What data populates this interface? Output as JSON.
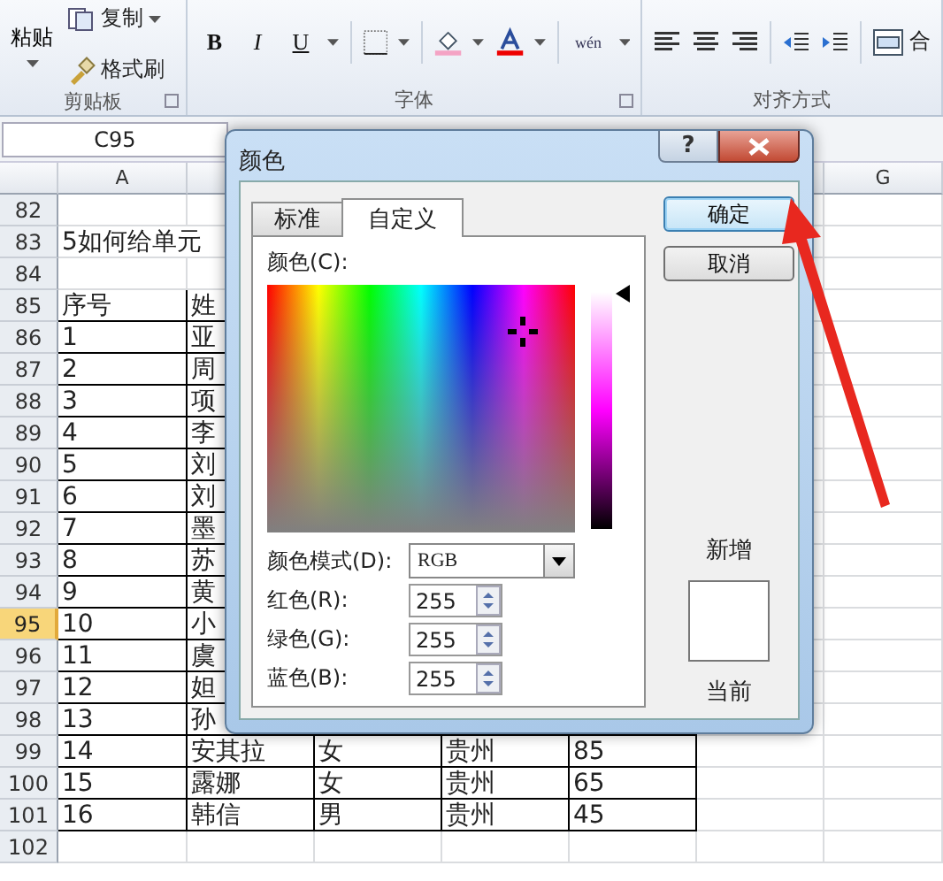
{
  "ribbon": {
    "groups": [
      {
        "kind": "clipboard",
        "label": "剪贴板",
        "paste": "粘贴",
        "copy": "复制",
        "format_painter": "格式刷"
      },
      {
        "kind": "font",
        "label": "字体",
        "bold": "B",
        "italic": "I",
        "underline": "U",
        "phonetic": "wén"
      },
      {
        "kind": "alignment",
        "label": "对齐方式",
        "merge": "合"
      }
    ]
  },
  "name_box": "C95",
  "sheet": {
    "column_headers": [
      "A",
      "G"
    ],
    "rows": [
      {
        "header": "82",
        "selected": false,
        "bordered": false,
        "cells": []
      },
      {
        "header": "83",
        "selected": false,
        "bordered": false,
        "cells": [
          "5如何给单元"
        ]
      },
      {
        "header": "84",
        "selected": false,
        "bordered": false,
        "cells": []
      },
      {
        "header": "85",
        "selected": false,
        "bordered": true,
        "cells": [
          "序号",
          "姓"
        ]
      },
      {
        "header": "86",
        "selected": false,
        "bordered": true,
        "cells": [
          "1",
          "亚"
        ]
      },
      {
        "header": "87",
        "selected": false,
        "bordered": true,
        "cells": [
          "2",
          "周"
        ]
      },
      {
        "header": "88",
        "selected": false,
        "bordered": true,
        "cells": [
          "3",
          "项"
        ]
      },
      {
        "header": "89",
        "selected": false,
        "bordered": true,
        "cells": [
          "4",
          "李"
        ]
      },
      {
        "header": "90",
        "selected": false,
        "bordered": true,
        "cells": [
          "5",
          "刘"
        ]
      },
      {
        "header": "91",
        "selected": false,
        "bordered": true,
        "cells": [
          "6",
          "刘"
        ]
      },
      {
        "header": "92",
        "selected": false,
        "bordered": true,
        "cells": [
          "7",
          "墨"
        ]
      },
      {
        "header": "93",
        "selected": false,
        "bordered": true,
        "cells": [
          "8",
          "苏"
        ]
      },
      {
        "header": "94",
        "selected": false,
        "bordered": true,
        "cells": [
          "9",
          "黄"
        ]
      },
      {
        "header": "95",
        "selected": true,
        "bordered": true,
        "cells": [
          "10",
          "小"
        ]
      },
      {
        "header": "96",
        "selected": false,
        "bordered": true,
        "cells": [
          "11",
          "虞"
        ]
      },
      {
        "header": "97",
        "selected": false,
        "bordered": true,
        "cells": [
          "12",
          "妲"
        ]
      },
      {
        "header": "98",
        "selected": false,
        "bordered": true,
        "cells": [
          "13",
          "孙"
        ]
      },
      {
        "header": "99",
        "selected": false,
        "bordered": true,
        "cells": [
          "14",
          "安其拉",
          "女",
          "贵州",
          "85"
        ]
      },
      {
        "header": "100",
        "selected": false,
        "bordered": true,
        "cells": [
          "15",
          "露娜",
          "女",
          "贵州",
          "65"
        ]
      },
      {
        "header": "101",
        "selected": false,
        "bordered": true,
        "cells": [
          "16",
          "韩信",
          "男",
          "贵州",
          "45"
        ]
      },
      {
        "header": "102",
        "selected": false,
        "bordered": false,
        "cells": []
      }
    ]
  },
  "dialog": {
    "title": "颜色",
    "help": "?",
    "tabs": [
      {
        "label": "标准",
        "selected": false
      },
      {
        "label": "自定义",
        "selected": true
      }
    ],
    "color_label": "颜色(C):",
    "lightness": {
      "level": 1
    },
    "mode": {
      "label": "颜色模式(D):",
      "value": "RGB"
    },
    "channels": [
      {
        "label": "红色(R):",
        "value": "255"
      },
      {
        "label": "绿色(G):",
        "value": "255"
      },
      {
        "label": "蓝色(B):",
        "value": "255"
      }
    ],
    "buttons": [
      {
        "label": "确定",
        "default": true
      },
      {
        "label": "取消",
        "default": false
      }
    ],
    "new_label": "新增",
    "current_label": "当前"
  }
}
